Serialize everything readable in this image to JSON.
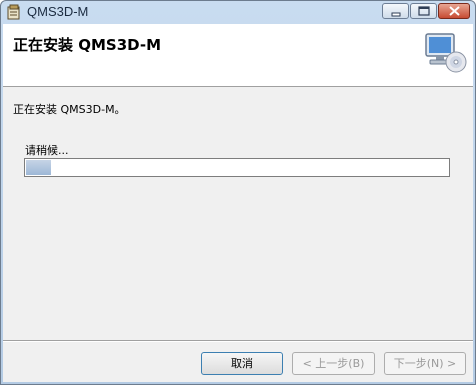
{
  "window": {
    "title": "QMS3D-M"
  },
  "header": {
    "title": "正在安装 QMS3D-M"
  },
  "main": {
    "status_text": "正在安装 QMS3D-M。",
    "progress_label": "请稍候...",
    "progress_fraction": 0.06
  },
  "buttons": {
    "cancel": "取消",
    "back": "< 上一步(B)",
    "next": "下一步(N) >"
  },
  "icons": {
    "app": "installer-app-icon",
    "header": "computer-disc-icon",
    "minimize": "minimize-icon",
    "maximize": "maximize-icon",
    "close": "close-icon"
  },
  "colors": {
    "title_bar": "#b4cbe4",
    "progress_fill": "#9db7d6",
    "close_button": "#c74b33"
  }
}
